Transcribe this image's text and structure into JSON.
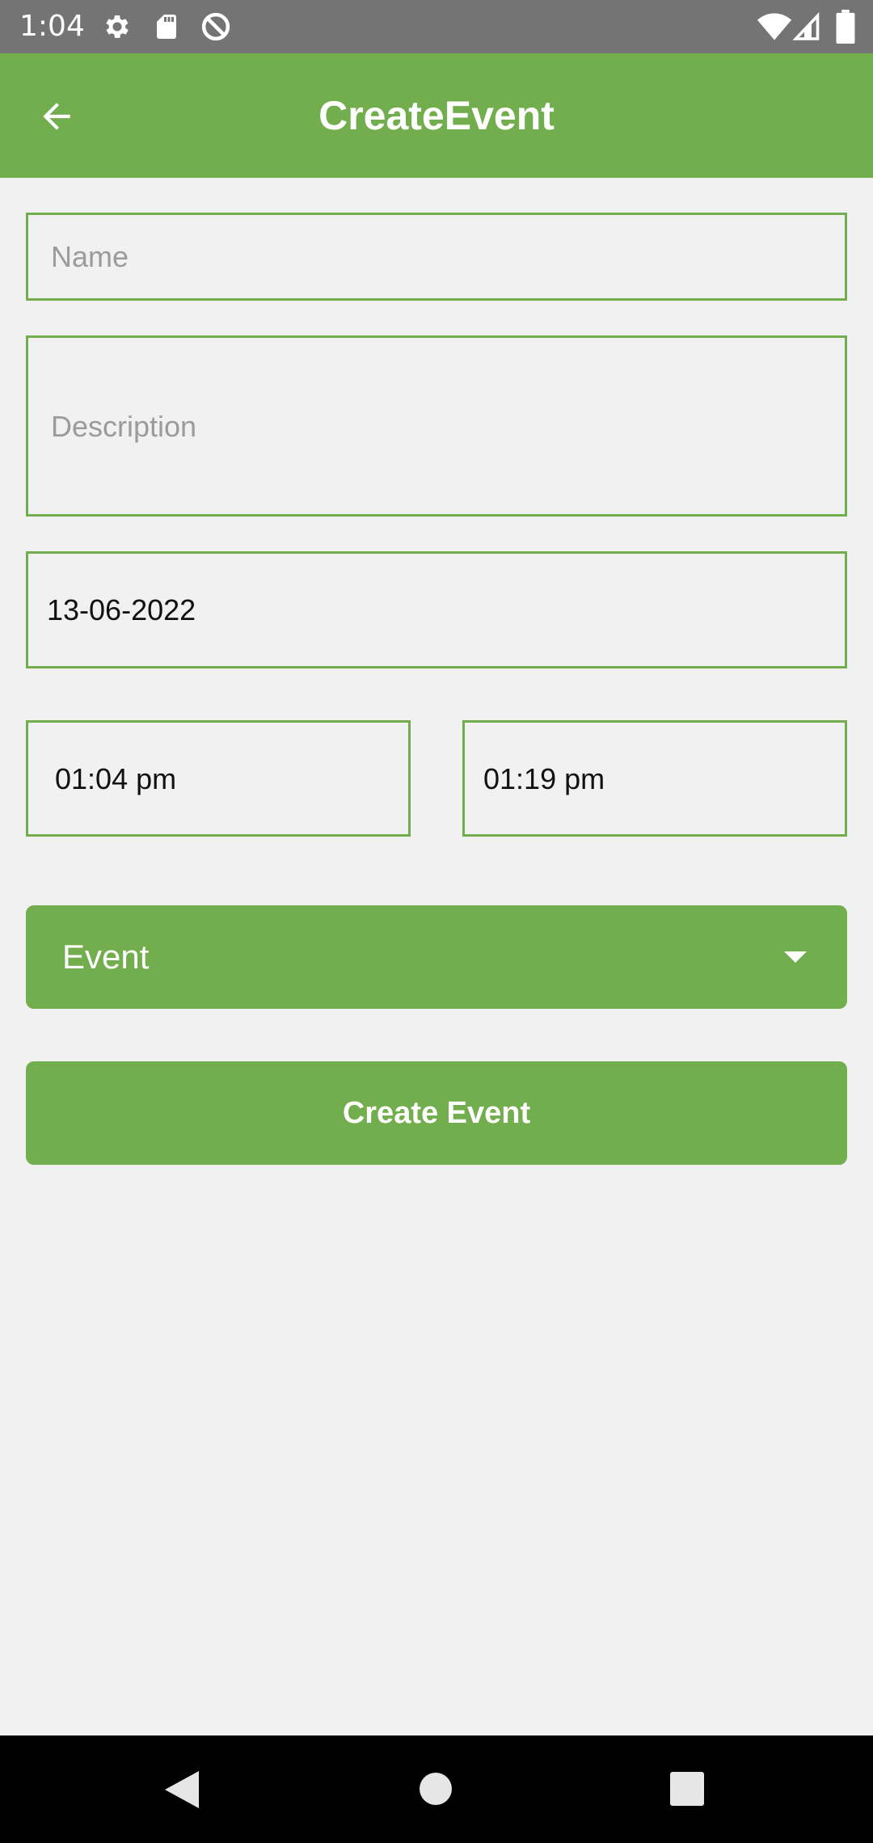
{
  "status_bar": {
    "time": "1:04",
    "left_icons": [
      "settings-icon",
      "sd-card-icon",
      "data-saver-icon"
    ],
    "right_icons": [
      "wifi-icon",
      "cell-signal-icon",
      "battery-icon"
    ]
  },
  "app_bar": {
    "title": "CreateEvent",
    "back_icon": "arrow-back-icon"
  },
  "form": {
    "name": {
      "placeholder": "Name",
      "value": ""
    },
    "description": {
      "placeholder": "Description",
      "value": ""
    },
    "date": "13-06-2022",
    "start_time": "01:04 pm",
    "end_time": "01:19 pm",
    "event_type": "Event",
    "submit_label": "Create Event"
  },
  "nav_bar": {
    "buttons": [
      "back-triangle-icon",
      "home-circle-icon",
      "recents-square-icon"
    ]
  },
  "colors": {
    "accent": "#72ae4d",
    "background": "#f1f1f1",
    "status_bar": "#747474",
    "nav_bar": "#000000"
  }
}
